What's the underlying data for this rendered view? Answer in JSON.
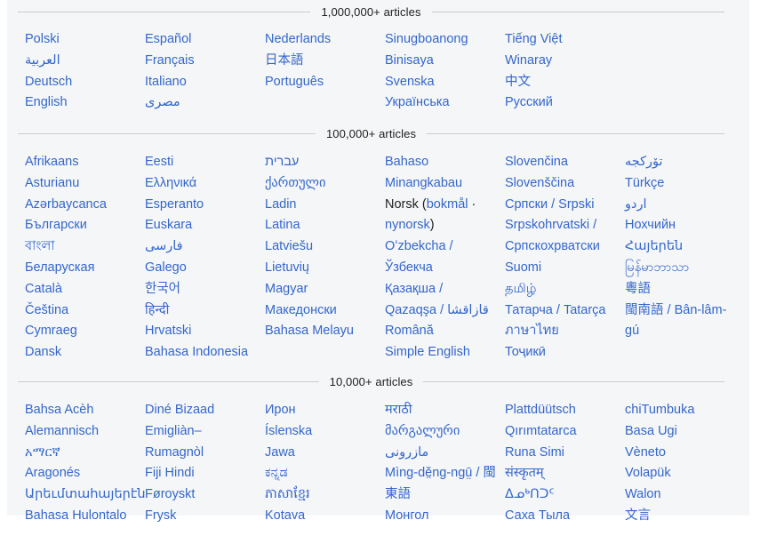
{
  "theme": {
    "link_color": "#3366cc",
    "text_color": "#202122",
    "rule_color": "#c8ccd1",
    "canvas_bg": "#f5f6f7",
    "page_bg": "#ffffff"
  },
  "sections": [
    {
      "id": "1000000",
      "heading": "1,000,000+ articles",
      "columns": [
        {
          "items": [
            {
              "label": "Polski"
            },
            {
              "label": "العربية",
              "rtl": true
            },
            {
              "label": "Deutsch"
            },
            {
              "label": "English"
            }
          ]
        },
        {
          "items": [
            {
              "label": "Español"
            },
            {
              "label": "Français"
            },
            {
              "label": "Italiano"
            },
            {
              "label": "مصرى",
              "rtl": true
            }
          ]
        },
        {
          "items": [
            {
              "label": "Nederlands"
            },
            {
              "label": "日本語"
            },
            {
              "label": "Português"
            }
          ]
        },
        {
          "items": [
            {
              "label": "Sinugboanong"
            },
            {
              "label": "Binisaya"
            },
            {
              "label": "Svenska"
            },
            {
              "label": "Українська"
            }
          ]
        },
        {
          "items": [
            {
              "label": "Tiếng Việt"
            },
            {
              "label": "Winaray"
            },
            {
              "label": "中文"
            },
            {
              "label": "Русский"
            }
          ]
        },
        {
          "items": []
        }
      ]
    },
    {
      "id": "100000",
      "heading": "100,000+ articles",
      "columns": [
        {
          "items": [
            {
              "label": "Afrikaans"
            },
            {
              "label": "Asturianu"
            },
            {
              "label": "Azərbaycanca"
            },
            {
              "label": "Български"
            },
            {
              "label": "বাংলা"
            },
            {
              "label": "Беларуская"
            },
            {
              "label": "Català"
            },
            {
              "label": "Čeština"
            },
            {
              "label": "Cymraeg"
            },
            {
              "label": "Dansk"
            }
          ]
        },
        {
          "items": [
            {
              "label": "Eesti"
            },
            {
              "label": "Ελληνικά"
            },
            {
              "label": "Esperanto"
            },
            {
              "label": "Euskara"
            },
            {
              "label": "فارسی",
              "rtl": true
            },
            {
              "label": "Galego"
            },
            {
              "label": "한국어"
            },
            {
              "label": "हिन्दी"
            },
            {
              "label": "Hrvatski"
            },
            {
              "label": "Bahasa Indonesia"
            }
          ]
        },
        {
          "items": [
            {
              "label": "עברית",
              "rtl": true
            },
            {
              "label": "ქართული"
            },
            {
              "label": "Ladin"
            },
            {
              "label": "Latina"
            },
            {
              "label": "Latviešu"
            },
            {
              "label": "Lietuvių"
            },
            {
              "label": "Magyar"
            },
            {
              "label": "Македонски"
            },
            {
              "label": "Bahasa Melayu"
            }
          ]
        },
        {
          "items": [
            {
              "label": "Bahaso Minangkabau"
            },
            {
              "composite": {
                "prefix": "Norsk (",
                "links": [
                  "bokmål",
                  "nynorsk"
                ],
                "separator": " · ",
                "suffix": ")"
              }
            },
            {
              "label": "Oʻzbekcha / Ўзбекча"
            },
            {
              "label": "Қазақша / Qazaqşa / قازاقشا"
            },
            {
              "label": "Română"
            },
            {
              "label": "Simple English"
            }
          ]
        },
        {
          "items": [
            {
              "label": "Slovenčina"
            },
            {
              "label": "Slovenščina"
            },
            {
              "label": "Српски / Srpski"
            },
            {
              "label": "Srpskohrvatski / Српскохрватски"
            },
            {
              "label": "Suomi"
            },
            {
              "label": "தமிழ்"
            },
            {
              "label": "Татарча / Tatarça"
            },
            {
              "label": "ภาษาไทย"
            },
            {
              "label": "Тоҷикӣ"
            }
          ]
        },
        {
          "items": [
            {
              "label": "تۆرکجه",
              "rtl": true
            },
            {
              "label": "Türkçe"
            },
            {
              "label": "اردو",
              "rtl": true
            },
            {
              "label": "Нохчийн"
            },
            {
              "label": "Հայերեն"
            },
            {
              "label": "မြန်မာဘာသာ"
            },
            {
              "label": "粵語"
            },
            {
              "label": "閩南語 / Bân-lâm-gú"
            }
          ]
        }
      ]
    },
    {
      "id": "10000",
      "heading": "10,000+ articles",
      "columns": [
        {
          "items": [
            {
              "label": "Bahsa Acèh"
            },
            {
              "label": "Alemannisch"
            },
            {
              "label": "አማርኛ"
            },
            {
              "label": "Aragonés"
            },
            {
              "label": "Արեւմտահայերէն"
            },
            {
              "label": "Bahasa Hulontalo"
            }
          ]
        },
        {
          "items": [
            {
              "label": "Diné Bizaad"
            },
            {
              "label": "Emigliàn–Rumagnòl"
            },
            {
              "label": "Fiji Hindi"
            },
            {
              "label": "Føroyskt"
            },
            {
              "label": "Frysk"
            }
          ]
        },
        {
          "items": [
            {
              "label": "Ирон"
            },
            {
              "label": "Íslenska"
            },
            {
              "label": "Jawa"
            },
            {
              "label": "ಕನ್ನಡ"
            },
            {
              "label": "ភាសាខ្មែរ"
            },
            {
              "label": "Kotava"
            }
          ]
        },
        {
          "items": [
            {
              "label": "मराठी"
            },
            {
              "label": "მარგალური"
            },
            {
              "label": "مازرونی",
              "rtl": true
            },
            {
              "label": "Mìng-dĕ̤ng-ngṳ̄ / 閩東語"
            },
            {
              "label": "Монгол"
            }
          ]
        },
        {
          "items": [
            {
              "label": "Plattdüütsch"
            },
            {
              "label": "Qırımtatarca"
            },
            {
              "label": "Runa Simi"
            },
            {
              "label": "संस्कृतम्"
            },
            {
              "label": "ᐃᓄᒃᑎᑐᑦ"
            },
            {
              "label": "Саха Тыла"
            }
          ]
        },
        {
          "items": [
            {
              "label": "chiTumbuka"
            },
            {
              "label": "Basa Ugi"
            },
            {
              "label": "Vèneto"
            },
            {
              "label": "Volapük"
            },
            {
              "label": "Walon"
            },
            {
              "label": "文言"
            }
          ]
        }
      ]
    }
  ]
}
